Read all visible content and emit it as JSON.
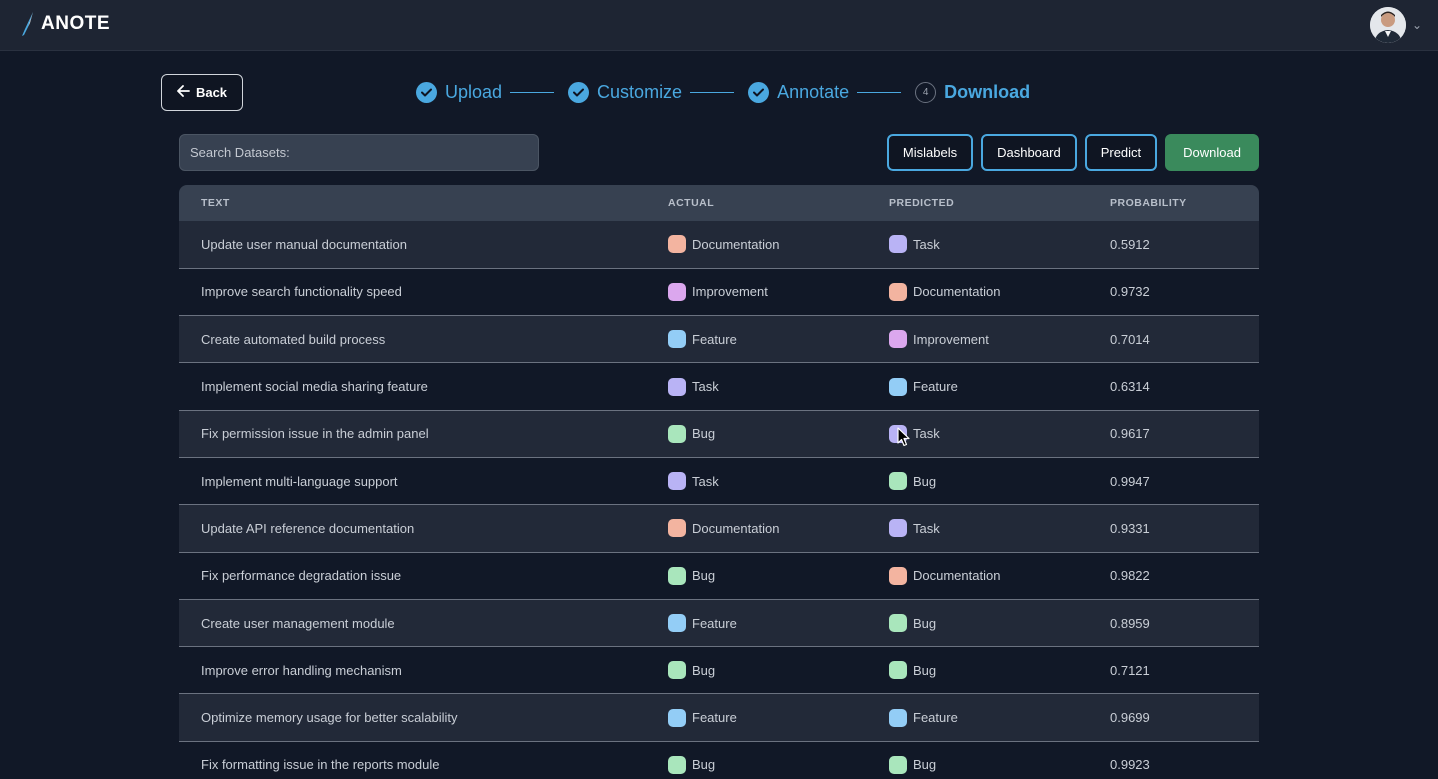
{
  "app": {
    "logo_text": "ANOTE"
  },
  "nav": {
    "back_label": "Back"
  },
  "stepper": [
    {
      "label": "Upload",
      "state": "done"
    },
    {
      "label": "Customize",
      "state": "done"
    },
    {
      "label": "Annotate",
      "state": "done"
    },
    {
      "label": "Download",
      "state": "active",
      "number": "4"
    }
  ],
  "search": {
    "placeholder": "Search Datasets:"
  },
  "actions": {
    "mislabels": "Mislabels",
    "dashboard": "Dashboard",
    "predict": "Predict",
    "download": "Download"
  },
  "table": {
    "headers": [
      "TEXT",
      "ACTUAL",
      "PREDICTED",
      "PROBABILITY"
    ],
    "label_colors": {
      "Documentation": "#f3b4a0",
      "Task": "#b9b3f5",
      "Improvement": "#dba7ee",
      "Feature": "#93cdf6",
      "Bug": "#a9e6bc"
    },
    "rows": [
      {
        "text": "Update user manual documentation",
        "actual": "Documentation",
        "predicted": "Task",
        "probability": "0.5912"
      },
      {
        "text": "Improve search functionality speed",
        "actual": "Improvement",
        "predicted": "Documentation",
        "probability": "0.9732"
      },
      {
        "text": "Create automated build process",
        "actual": "Feature",
        "predicted": "Improvement",
        "probability": "0.7014"
      },
      {
        "text": "Implement social media sharing feature",
        "actual": "Task",
        "predicted": "Feature",
        "probability": "0.6314"
      },
      {
        "text": "Fix permission issue in the admin panel",
        "actual": "Bug",
        "predicted": "Task",
        "probability": "0.9617"
      },
      {
        "text": "Implement multi-language support",
        "actual": "Task",
        "predicted": "Bug",
        "probability": "0.9947"
      },
      {
        "text": "Update API reference documentation",
        "actual": "Documentation",
        "predicted": "Task",
        "probability": "0.9331"
      },
      {
        "text": "Fix performance degradation issue",
        "actual": "Bug",
        "predicted": "Documentation",
        "probability": "0.9822"
      },
      {
        "text": "Create user management module",
        "actual": "Feature",
        "predicted": "Bug",
        "probability": "0.8959"
      },
      {
        "text": "Improve error handling mechanism",
        "actual": "Bug",
        "predicted": "Bug",
        "probability": "0.7121"
      },
      {
        "text": "Optimize memory usage for better scalability",
        "actual": "Feature",
        "predicted": "Feature",
        "probability": "0.9699"
      },
      {
        "text": "Fix formatting issue in the reports module",
        "actual": "Bug",
        "predicted": "Bug",
        "probability": "0.9923"
      }
    ]
  }
}
